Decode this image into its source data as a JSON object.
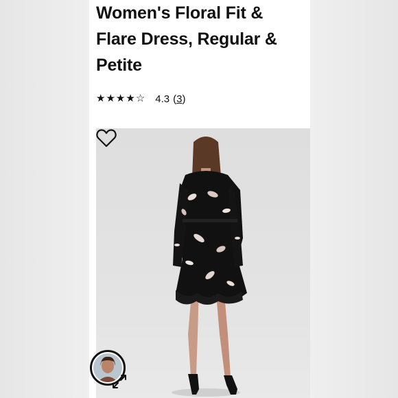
{
  "product": {
    "title_lines": [
      "Women's Floral Fit &",
      "Flare Dress, Regular &",
      "Petite"
    ],
    "rating": {
      "stars_filled": 4,
      "stars_total": 5,
      "value": "4.3",
      "count_open": "(",
      "count": "3",
      "count_close": ")"
    },
    "image": {
      "icons": [
        "heart-outline-icon"
      ]
    }
  },
  "seller": {
    "icons": [
      "avatar",
      "expand-icon"
    ]
  },
  "colors": {
    "page_bg": "#ebebeb",
    "card_bg": "#ffffff",
    "text": "#111111",
    "image_bg": "#dedede"
  }
}
